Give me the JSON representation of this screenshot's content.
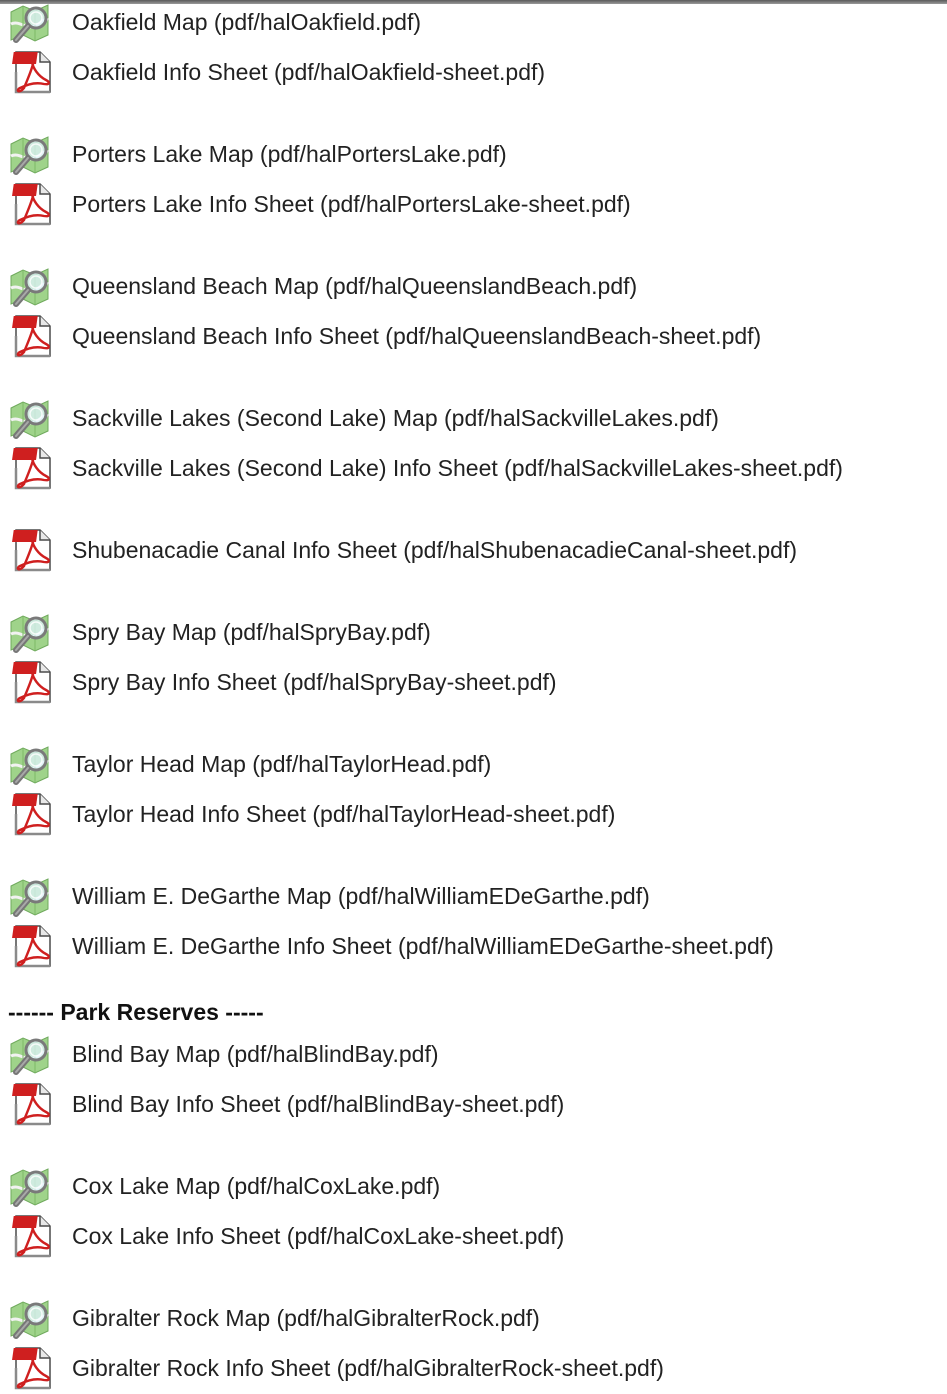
{
  "sections": [
    {
      "heading": null,
      "groups": [
        [
          {
            "icon": "map-search-icon",
            "label": "Oakfield Map (pdf/halOakfield.pdf)"
          },
          {
            "icon": "pdf-icon",
            "label": "Oakfield Info Sheet (pdf/halOakfield-sheet.pdf)"
          }
        ],
        [
          {
            "icon": "map-search-icon",
            "label": "Porters Lake Map (pdf/halPortersLake.pdf)"
          },
          {
            "icon": "pdf-icon",
            "label": "Porters Lake Info Sheet (pdf/halPortersLake-sheet.pdf)"
          }
        ],
        [
          {
            "icon": "map-search-icon",
            "label": "Queensland Beach Map (pdf/halQueenslandBeach.pdf)"
          },
          {
            "icon": "pdf-icon",
            "label": "Queensland Beach Info Sheet (pdf/halQueenslandBeach-sheet.pdf)"
          }
        ],
        [
          {
            "icon": "map-search-icon",
            "label": "Sackville Lakes (Second Lake) Map (pdf/halSackvilleLakes.pdf)"
          },
          {
            "icon": "pdf-icon",
            "label": "Sackville Lakes (Second Lake) Info Sheet (pdf/halSackvilleLakes-sheet.pdf)"
          }
        ],
        [
          {
            "icon": "pdf-icon",
            "label": "Shubenacadie Canal Info Sheet (pdf/halShubenacadieCanal-sheet.pdf)"
          }
        ],
        [
          {
            "icon": "map-search-icon",
            "label": "Spry Bay Map (pdf/halSpryBay.pdf)"
          },
          {
            "icon": "pdf-icon",
            "label": "Spry Bay Info Sheet (pdf/halSpryBay-sheet.pdf)"
          }
        ],
        [
          {
            "icon": "map-search-icon",
            "label": "Taylor Head Map (pdf/halTaylorHead.pdf)"
          },
          {
            "icon": "pdf-icon",
            "label": "Taylor Head Info Sheet (pdf/halTaylorHead-sheet.pdf)"
          }
        ],
        [
          {
            "icon": "map-search-icon",
            "label": "William E. DeGarthe Map (pdf/halWilliamEDeGarthe.pdf)"
          },
          {
            "icon": "pdf-icon",
            "label": "William E. DeGarthe Info Sheet (pdf/halWilliamEDeGarthe-sheet.pdf)"
          }
        ]
      ]
    },
    {
      "heading": "------ Park Reserves -----",
      "groups": [
        [
          {
            "icon": "map-search-icon",
            "label": "Blind Bay Map (pdf/halBlindBay.pdf)"
          },
          {
            "icon": "pdf-icon",
            "label": "Blind Bay Info Sheet (pdf/halBlindBay-sheet.pdf)"
          }
        ],
        [
          {
            "icon": "map-search-icon",
            "label": "Cox Lake Map (pdf/halCoxLake.pdf)"
          },
          {
            "icon": "pdf-icon",
            "label": "Cox Lake Info Sheet (pdf/halCoxLake-sheet.pdf)"
          }
        ],
        [
          {
            "icon": "map-search-icon",
            "label": "Gibralter Rock Map (pdf/halGibralterRock.pdf)"
          },
          {
            "icon": "pdf-icon",
            "label": "Gibralter Rock Info Sheet (pdf/halGibralterRock-sheet.pdf)"
          }
        ]
      ]
    }
  ]
}
